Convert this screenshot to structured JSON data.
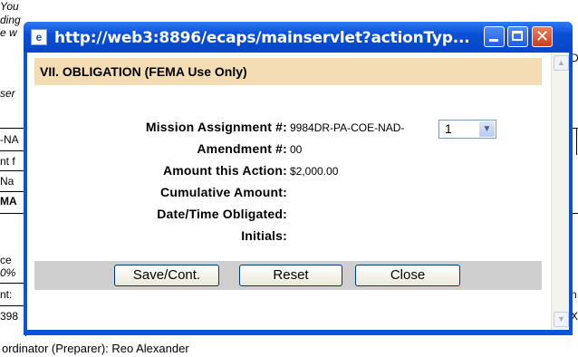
{
  "background": {
    "left_fragments": [
      "You",
      "ding",
      "e w",
      "ser",
      "-NA",
      "nt f",
      "Na",
      "MA",
      "ce",
      "0%",
      "nt:",
      "398"
    ],
    "top_fragment_left": "... . . . . . . . . . . . . . . . . . . .",
    "right_fragments": [
      "D",
      "n",
      "X"
    ],
    "footer_text": "ordinator (Preparer): Reo Alexander"
  },
  "window": {
    "title": "http://web3:8896/ecaps/mainservlet?actionTyp...",
    "title_icon_glyph": "e",
    "minimize_glyph": "_",
    "maximize_glyph": "□",
    "close_glyph": "✕"
  },
  "section": {
    "header": "VII. OBLIGATION (FEMA Use Only)"
  },
  "fields": [
    {
      "label": "Mission Assignment #:",
      "value": "9984DR-PA-COE-NAD-"
    },
    {
      "label": "Amendment #:",
      "value": "00"
    },
    {
      "label": "Amount this Action:",
      "value": "$2,000.00"
    },
    {
      "label": "Cumulative Amount:",
      "value": ""
    },
    {
      "label": "Date/Time Obligated:",
      "value": ""
    },
    {
      "label": "Initials:",
      "value": ""
    }
  ],
  "select": {
    "value": "1"
  },
  "buttons": {
    "save": "Save/Cont.",
    "reset": "Reset",
    "close": "Close"
  },
  "scrollbar": {
    "up_glyph": "▲",
    "down_glyph": "▼"
  }
}
